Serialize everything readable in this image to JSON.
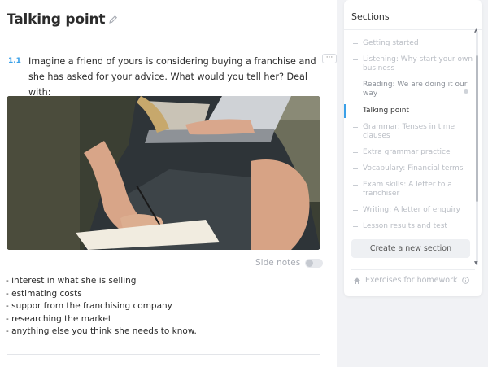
{
  "lesson": {
    "title": "Talking point"
  },
  "task": {
    "number": "1.1",
    "text": "Imagine a friend of yours is considering buying a franchise and she has asked for your advice. What would you tell her? Deal with:",
    "more_label": "···"
  },
  "side_notes": {
    "label": "Side notes",
    "enabled": false
  },
  "bullets": [
    "- interest in what she is selling",
    "- estimating costs",
    "- suppor from the franchising company",
    "- researching the market",
    "- anything else you think she needs to know."
  ],
  "sidebar": {
    "title": "Sections",
    "items": [
      {
        "label": "Getting started"
      },
      {
        "label": "Listening: Why start your own business"
      },
      {
        "label": "Reading: We are doing it our way"
      },
      {
        "label": "Talking point"
      },
      {
        "label": "Grammar: Tenses in time clauses"
      },
      {
        "label": "Extra grammar practice"
      },
      {
        "label": "Vocabulary: Financial terms"
      },
      {
        "label": "Exam skills: A letter to a franchiser"
      },
      {
        "label": "Writing: A letter of enquiry"
      },
      {
        "label": "Lesson results and test"
      }
    ],
    "create_label": "Create a new section",
    "homework_label": "Exercises for homework"
  },
  "colors": {
    "accent": "#3aa0e8",
    "muted_text": "#b9bdc4"
  },
  "icons": [
    "pencil-icon",
    "more-icon",
    "home-icon",
    "info-icon"
  ]
}
